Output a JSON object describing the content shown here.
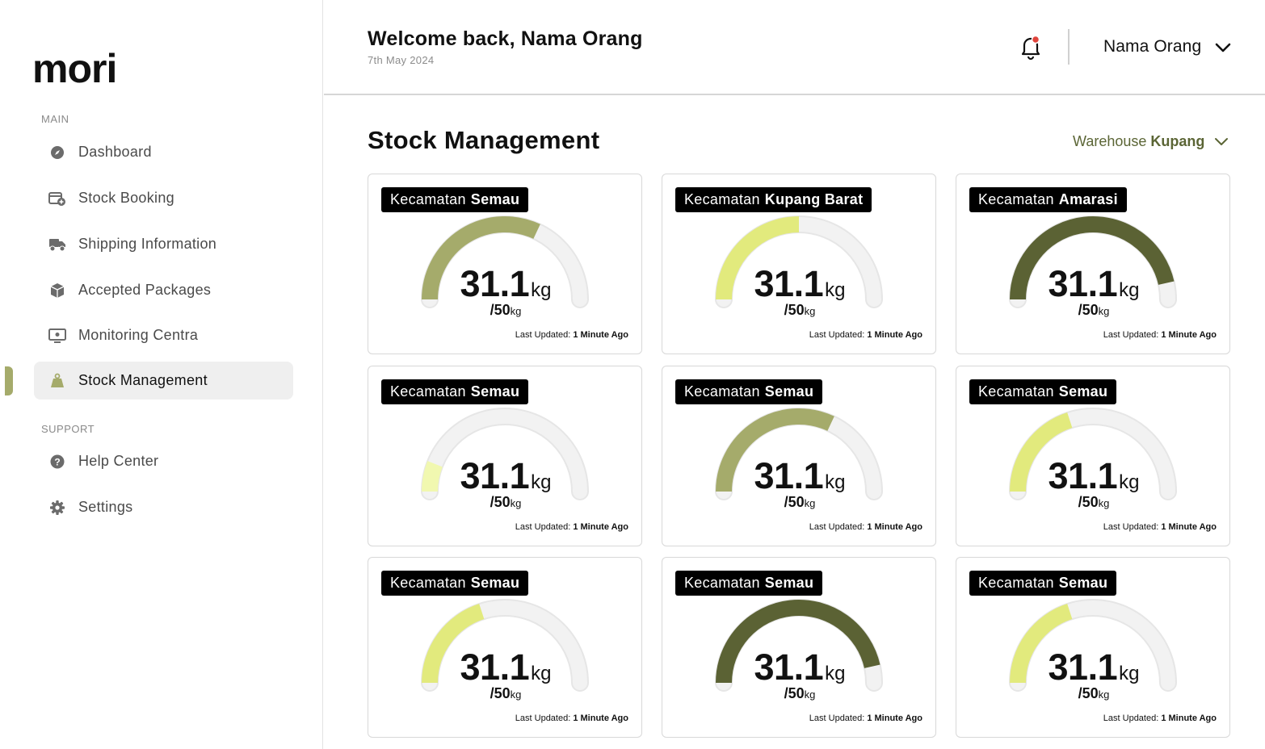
{
  "sidebar": {
    "logo_text": "mori",
    "main_label": "MAIN",
    "support_label": "SUPPORT",
    "items": [
      {
        "label": "Dashboard",
        "icon": "compass-icon"
      },
      {
        "label": "Stock Booking",
        "icon": "calendar-add-icon"
      },
      {
        "label": "Shipping Information",
        "icon": "truck-icon"
      },
      {
        "label": "Accepted Packages",
        "icon": "box-icon"
      },
      {
        "label": "Monitoring Centra",
        "icon": "monitor-icon"
      },
      {
        "label": "Stock Management",
        "icon": "weight-icon",
        "active": true
      }
    ],
    "support_items": [
      {
        "label": "Help Center",
        "icon": "help-icon"
      },
      {
        "label": "Settings",
        "icon": "gear-icon"
      }
    ]
  },
  "header": {
    "welcome": "Welcome back, Nama Orang",
    "date": "7th May 2024",
    "user_name": "Nama Orang"
  },
  "main": {
    "title": "Stock Management",
    "warehouse_label": "Warehouse",
    "warehouse_name": "Kupang"
  },
  "colors": {
    "accent_olive_light": "#a5ab6b",
    "accent_yellow": "#e2ea7d",
    "accent_olive_dark": "#5b6234",
    "accent_pale": "#f1f8b0",
    "track": "#efefef",
    "notification_dot": "#e0443c"
  },
  "cards": [
    {
      "prefix": "Kecamatan",
      "name": "Semau",
      "value": "31.1",
      "unit": "kg",
      "cap_value": "/50",
      "cap_unit": "kg",
      "updated_label": "Last Updated:",
      "updated_value": "1 Minute Ago",
      "fill": 0.64,
      "color": "#a5ab6b"
    },
    {
      "prefix": "Kecamatan",
      "name": "Kupang Barat",
      "value": "31.1",
      "unit": "kg",
      "cap_value": "/50",
      "cap_unit": "kg",
      "updated_label": "Last Updated:",
      "updated_value": "1 Minute Ago",
      "fill": 0.5,
      "color": "#e2ea7d"
    },
    {
      "prefix": "Kecamatan",
      "name": "Amarasi",
      "value": "31.1",
      "unit": "kg",
      "cap_value": "/50",
      "cap_unit": "kg",
      "updated_label": "Last Updated:",
      "updated_value": "1 Minute Ago",
      "fill": 0.93,
      "color": "#5b6234"
    },
    {
      "prefix": "Kecamatan",
      "name": "Semau",
      "value": "31.1",
      "unit": "kg",
      "cap_value": "/50",
      "cap_unit": "kg",
      "updated_label": "Last Updated:",
      "updated_value": "1 Minute Ago",
      "fill": 0.12,
      "color": "#f1f8b0"
    },
    {
      "prefix": "Kecamatan",
      "name": "Semau",
      "value": "31.1",
      "unit": "kg",
      "cap_value": "/50",
      "cap_unit": "kg",
      "updated_label": "Last Updated:",
      "updated_value": "1 Minute Ago",
      "fill": 0.64,
      "color": "#a5ab6b"
    },
    {
      "prefix": "Kecamatan",
      "name": "Semau",
      "value": "31.1",
      "unit": "kg",
      "cap_value": "/50",
      "cap_unit": "kg",
      "updated_label": "Last Updated:",
      "updated_value": "1 Minute Ago",
      "fill": 0.4,
      "color": "#e2ea7d"
    },
    {
      "prefix": "Kecamatan",
      "name": "Semau",
      "value": "31.1",
      "unit": "kg",
      "cap_value": "/50",
      "cap_unit": "kg",
      "updated_label": "Last Updated:",
      "updated_value": "1 Minute Ago",
      "fill": 0.4,
      "color": "#e2ea7d"
    },
    {
      "prefix": "Kecamatan",
      "name": "Semau",
      "value": "31.1",
      "unit": "kg",
      "cap_value": "/50",
      "cap_unit": "kg",
      "updated_label": "Last Updated:",
      "updated_value": "1 Minute Ago",
      "fill": 0.93,
      "color": "#5b6234"
    },
    {
      "prefix": "Kecamatan",
      "name": "Semau",
      "value": "31.1",
      "unit": "kg",
      "cap_value": "/50",
      "cap_unit": "kg",
      "updated_label": "Last Updated:",
      "updated_value": "1 Minute Ago",
      "fill": 0.4,
      "color": "#e2ea7d"
    }
  ]
}
